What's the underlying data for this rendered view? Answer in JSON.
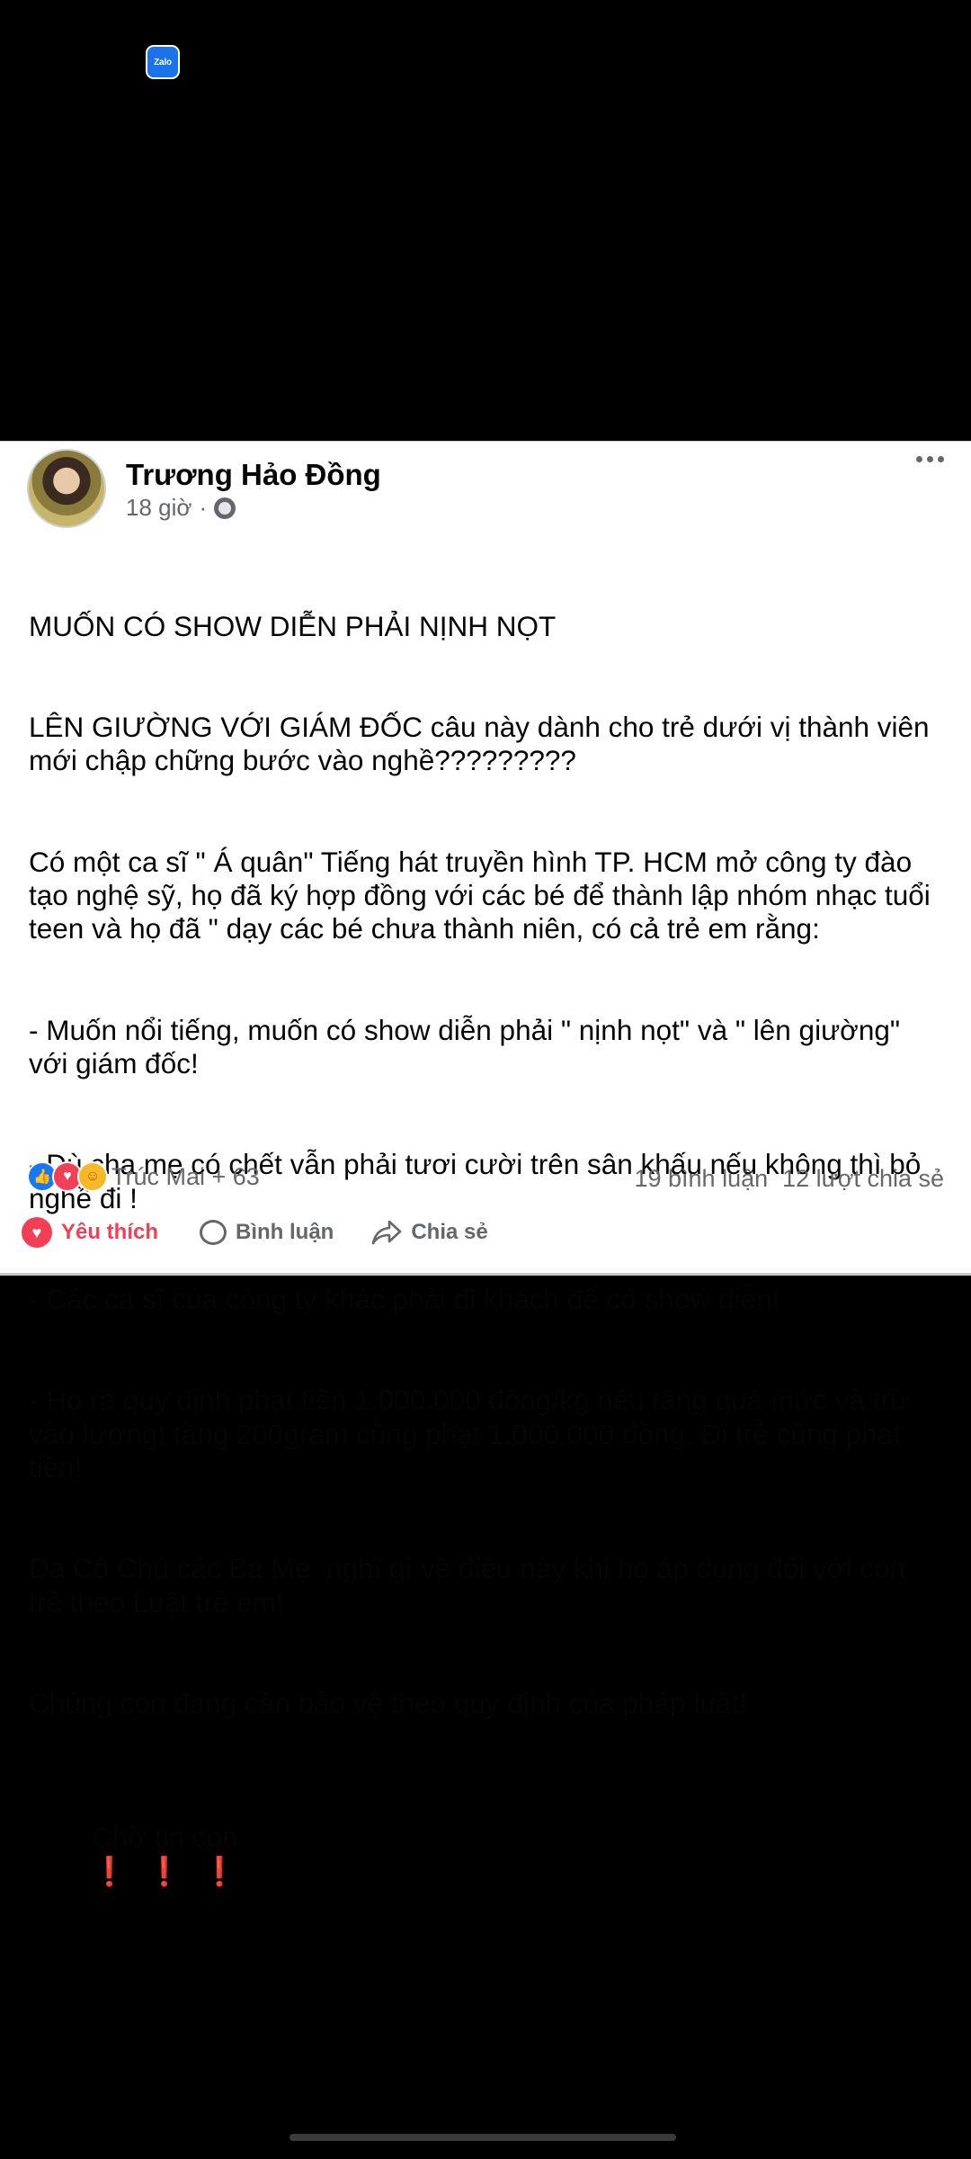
{
  "status_bar": {
    "zalo_icon_label": "Zalo"
  },
  "post": {
    "author": "Trương Hảo Đồng",
    "time": "18 giờ",
    "separator": "·",
    "lines": [
      "MUỐN CÓ SHOW DIỄN PHẢI NỊNH NỌT",
      "LÊN GIƯỜNG VỚI GIÁM ĐỐC câu này dành cho trẻ dưới vị thành viên mới chập chững bước vào nghề?????????",
      "Có một ca sĩ \" Á quân\" Tiếng hát truyền hình TP. HCM mở công ty đào tạo nghệ sỹ, họ đã ký hợp đồng với các bé để thành lập nhóm nhạc tuổi teen và họ đã \" dạy các bé chưa thành niên, có cả trẻ em rằng:",
      "- Muốn nổi tiếng, muốn có show diễn phải \" nịnh nọt\" và \" lên giường\" với giám đốc!",
      "- Dù cha mẹ có chết vẫn phải tươi cười trên sân khấu nếu không thì bỏ nghề đi !",
      "- Các ca sĩ của công ty khác phải đi khách để có show diễn!",
      "- Họ ra quy định phạt tiền 1.000.000 đồng/kg nếu tăng quá mức và trừ vào lương! tăng 200gram cũng phạt 1.000.000 đồng. Đi trễ cũng phạt tiền!",
      "Dạ Cô Chú các Ba Mẹ  nghĩ gì về điều này khi họ áp dụng đối với con trẻ theo Luật trẻ em!",
      "Chúng con đang cần bảo vệ theo quy định của pháp luật!"
    ],
    "last_line_text": "Chờ tin con",
    "last_line_emoji": "❗❗❗",
    "reactions_text": "Trúc Mai + 63",
    "comments_count": "19 bình luận",
    "shares_count": "12 lượt chia sẻ",
    "colors": {
      "like": "#1877f2",
      "love": "#f33e58",
      "text": "#050505",
      "secondary": "#65676b"
    }
  },
  "actions": {
    "like_label": "Yêu thích",
    "comment_label": "Bình luận",
    "share_label": "Chia sẻ"
  }
}
